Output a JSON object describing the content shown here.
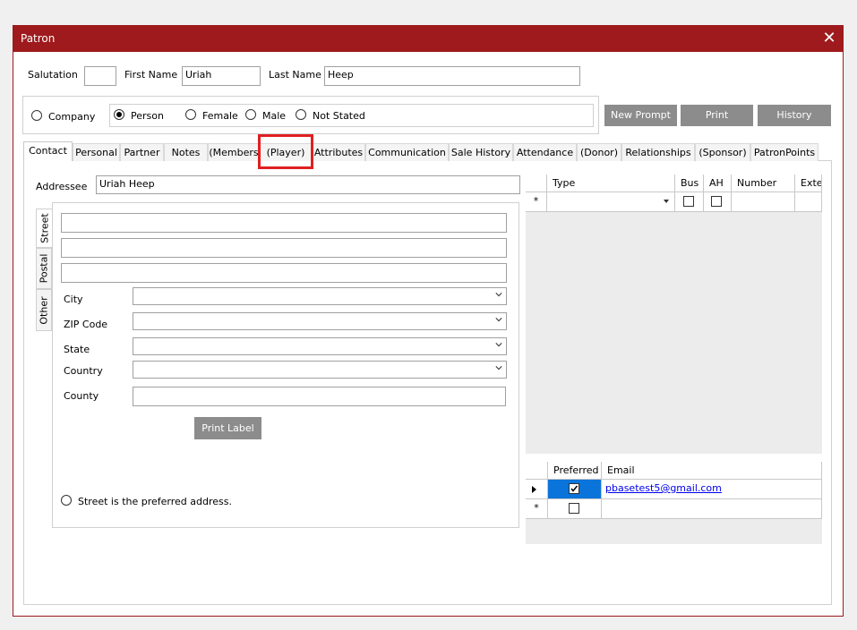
{
  "window": {
    "title": "Patron"
  },
  "header": {
    "salutation_label": "Salutation",
    "salutation_value": "",
    "first_name_label": "First Name",
    "first_name_value": "Uriah",
    "last_name_label": "Last Name",
    "last_name_value": "Heep"
  },
  "type_radios": {
    "company": "Company",
    "person": "Person",
    "selected": "person"
  },
  "gender_radios": {
    "female": "Female",
    "male": "Male",
    "not_stated": "Not Stated",
    "selected": "not_stated"
  },
  "buttons": {
    "new_prompt": "New Prompt",
    "print": "Print",
    "history": "History"
  },
  "tabs": [
    "Contact",
    "Personal",
    "Partner",
    "Notes",
    "(Members",
    "(Player)",
    "Attributes",
    "Communication",
    "Sale History",
    "Attendance",
    "(Donor)",
    "Relationships",
    "(Sponsor)",
    "PatronPoints"
  ],
  "active_tab": "Contact",
  "contact": {
    "addressee_label": "Addressee",
    "addressee_value": "Uriah Heep",
    "address_tabs": [
      "Street",
      "Postal",
      "Other"
    ],
    "street_lines": [
      "",
      "",
      ""
    ],
    "city_label": "City",
    "zip_label": "ZIP Code",
    "state_label": "State",
    "country_label": "Country",
    "county_label": "County",
    "print_label_button": "Print Label",
    "preferred_address_label": "Street is the preferred address."
  },
  "phone_grid": {
    "columns": [
      "Type",
      "Bus",
      "AH",
      "Number",
      "Exte"
    ],
    "new_row_marker": "*"
  },
  "email_grid": {
    "columns": [
      "Preferred",
      "Email"
    ],
    "rows": [
      {
        "preferred": true,
        "email": "pbasetest5@gmail.com"
      }
    ],
    "new_row_marker": "*"
  },
  "colors": {
    "titlebar": "#9e1a1c",
    "highlight_box": "#e02020",
    "selected_cell": "#0a74da",
    "button": "#8c8c8c"
  }
}
